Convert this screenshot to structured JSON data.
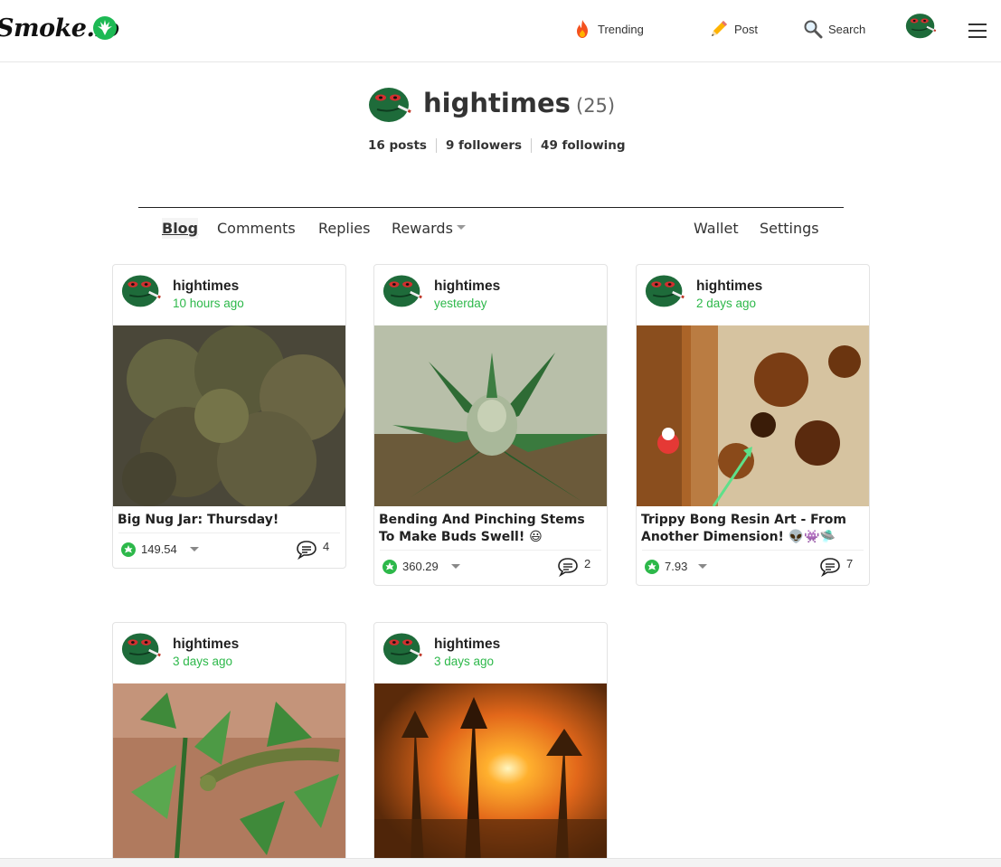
{
  "nav": {
    "logo": "Smoke.io",
    "trending": "Trending",
    "post": "Post",
    "search": "Search"
  },
  "profile": {
    "name": "hightimes",
    "reputation": "(25)",
    "posts": "16 posts",
    "followers": "9 followers",
    "following": "49 following"
  },
  "tabs": {
    "blog": "Blog",
    "comments": "Comments",
    "replies": "Replies",
    "rewards": "Rewards",
    "wallet": "Wallet",
    "settings": "Settings"
  },
  "posts": [
    {
      "author": "hightimes",
      "time": "10 hours ago",
      "title": "Big Nug Jar: Thursday!",
      "payout": "149.54",
      "comments": "4"
    },
    {
      "author": "hightimes",
      "time": "yesterday",
      "title": "Bending And Pinching Stems To Make Buds Swell! 😃",
      "payout": "360.29",
      "comments": "2"
    },
    {
      "author": "hightimes",
      "time": "2 days ago",
      "title": "Trippy Bong Resin Art - From Another Dimension! 👽👾🛸",
      "payout": "7.93",
      "comments": "7"
    },
    {
      "author": "hightimes",
      "time": "3 days ago"
    },
    {
      "author": "hightimes",
      "time": "3 days ago"
    }
  ],
  "colors": {
    "accent": "#2db84a",
    "avatar": "#1e6b3a"
  },
  "icons": [
    "leaf-icon",
    "fire-icon",
    "pencil-icon",
    "magnifier-icon",
    "menu-icon",
    "comment-icon",
    "steem-power-icon"
  ]
}
